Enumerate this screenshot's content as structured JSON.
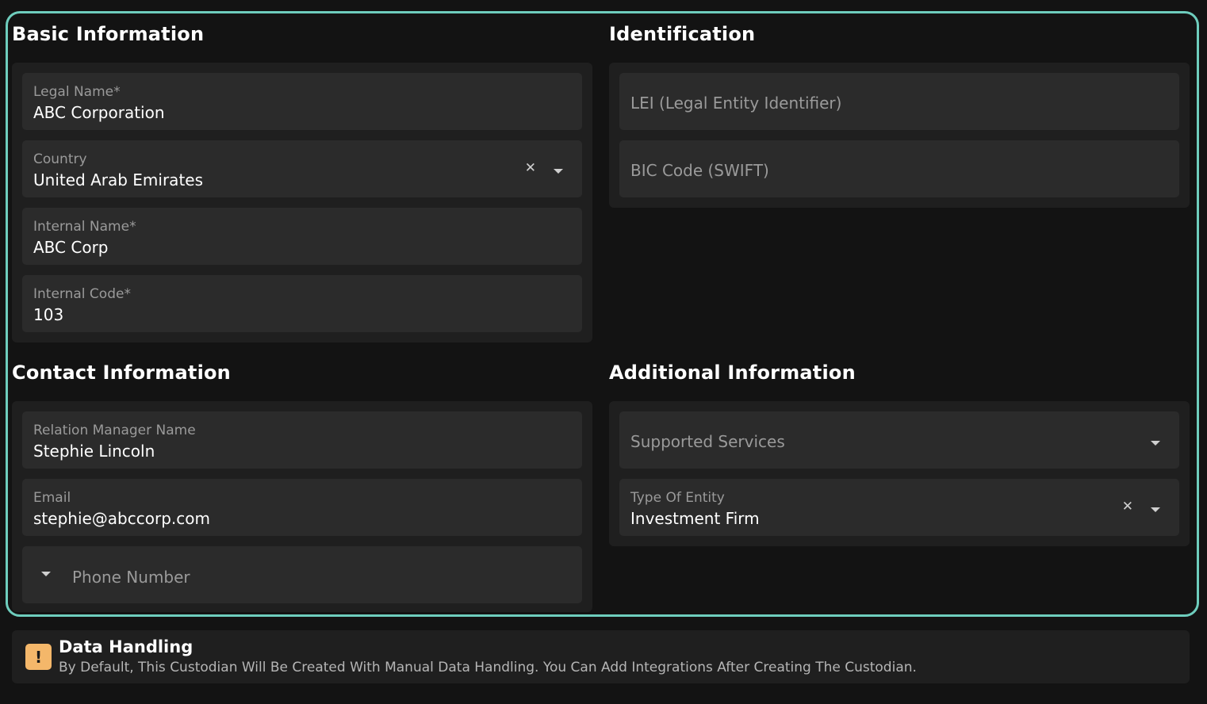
{
  "basic_information": {
    "title": "Basic Information",
    "legal_name": {
      "label": "Legal Name*",
      "value": "ABC Corporation"
    },
    "country": {
      "label": "Country",
      "value": "United Arab Emirates"
    },
    "internal_name": {
      "label": "Internal Name*",
      "value": "ABC Corp"
    },
    "internal_code": {
      "label": "Internal Code*",
      "value": "103"
    }
  },
  "identification": {
    "title": "Identification",
    "lei": {
      "placeholder": "LEI (Legal Entity Identifier)"
    },
    "bic": {
      "placeholder": "BIC Code (SWIFT)"
    }
  },
  "contact_information": {
    "title": "Contact Information",
    "relation_manager": {
      "label": "Relation Manager Name",
      "value": "Stephie Lincoln"
    },
    "email": {
      "label": "Email",
      "value": "stephie@abccorp.com"
    },
    "phone": {
      "placeholder": "Phone Number"
    }
  },
  "additional_information": {
    "title": "Additional Information",
    "supported_services": {
      "placeholder": "Supported Services"
    },
    "entity_type": {
      "label": "Type Of Entity",
      "value": "Investment Firm"
    }
  },
  "notice": {
    "icon": "!",
    "title": "Data Handling",
    "text": "By Default, This Custodian Will Be Created With Manual Data Handling. You Can Add Integrations After Creating The Custodian."
  },
  "icons": {
    "clear": "clear-icon",
    "dropdown": "chevron-down-icon",
    "warning": "warning-icon"
  },
  "colors": {
    "accent_border": "#6ecdbd",
    "warning": "#f4b76a",
    "background": "#131313",
    "card": "#1f1f1f",
    "field": "#2b2b2b"
  }
}
